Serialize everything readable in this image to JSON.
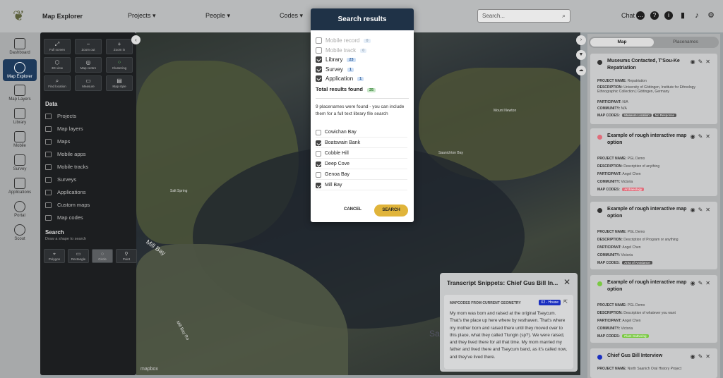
{
  "topbar": {
    "title": "Map Explorer",
    "nav": [
      "Projects",
      "People",
      "Codes"
    ],
    "search_placeholder": "Search...",
    "chat_label": "Chat"
  },
  "leftnav": [
    "Dashboard",
    "Map Explorer",
    "Map Layers",
    "Library",
    "Mobile",
    "Survey",
    "Applications",
    "Portal",
    "Scout"
  ],
  "sidepanel": {
    "tools": [
      "Full screen",
      "Zoom out",
      "Zoom in",
      "3D view",
      "Map centre",
      "Clustering",
      "Find location",
      "Measure",
      "Map style"
    ],
    "data_heading": "Data",
    "data_items": [
      "Projects",
      "Map layers",
      "Maps",
      "Mobile apps",
      "Mobile tracks",
      "Surveys",
      "Applications",
      "Custom maps",
      "Map codes"
    ],
    "search_heading": "Search",
    "search_sub": "Draw a shape to search",
    "shapes": [
      "Polygon",
      "Rectangle",
      "Circle",
      "Point"
    ]
  },
  "map": {
    "labels": [
      "Mill Bay",
      "Mill Bay Ro",
      "Sa",
      "Salt Spring",
      "Saanichton Bay",
      "Mount Newton"
    ],
    "attribution": "mapbox"
  },
  "modal": {
    "title": "Search results",
    "results": [
      {
        "label": "Mobile record",
        "count": "0",
        "checked": false,
        "disabled": true
      },
      {
        "label": "Mobile track",
        "count": "0",
        "checked": false,
        "disabled": true
      },
      {
        "label": "Library",
        "count": "23",
        "checked": true,
        "disabled": false
      },
      {
        "label": "Survey",
        "count": "1",
        "checked": true,
        "disabled": false
      },
      {
        "label": "Application",
        "count": "1",
        "checked": true,
        "disabled": false
      }
    ],
    "total_label": "Total results found",
    "total_count": "25",
    "info": "9 placenames were found - you can include them for a full text library file search",
    "placenames": [
      {
        "label": "Cowichan Bay",
        "checked": false
      },
      {
        "label": "Boatswain Bank",
        "checked": true
      },
      {
        "label": "Cobble Hill",
        "checked": false
      },
      {
        "label": "Deep Cove",
        "checked": true
      },
      {
        "label": "Genoa Bay",
        "checked": false
      },
      {
        "label": "Mill Bay",
        "checked": true
      }
    ],
    "cancel_label": "CANCEL",
    "search_label": "SEARCH"
  },
  "rightpanel": {
    "tab_map": "Map",
    "tab_placenames": "Placenames",
    "library_strip": "Library",
    "cards": [
      {
        "title": "Museums Contacted, T'Sou-Ke Repatriation",
        "dot_color": "#333333",
        "project_name": "Repatriation",
        "description": "University of Göttingen, Institute for Ethnology Ethnographic Collection | Göttingen, Germany",
        "participant": "N/A",
        "community": "N/A",
        "map_codes": [
          "Museum Location",
          "No Response"
        ],
        "tag_colors": [
          "#666666",
          "#555555"
        ]
      },
      {
        "title": "Example of rough interactive map option",
        "dot_color": "#e06c7a",
        "project_name": "PGL Demo",
        "description": "Description of anything",
        "participant": "Angel Chen",
        "community": "Victoria",
        "map_codes": [
          "Archaeology"
        ],
        "tag_colors": [
          "#e06c7a"
        ]
      },
      {
        "title": "Example of rough interactive map option",
        "dot_color": "#333333",
        "project_name": "PGL Demo",
        "description": "Description of Program or anything",
        "participant": "Angel Chen",
        "community": "Victoria",
        "map_codes": [
          "Area of Avoidance"
        ],
        "tag_colors": [
          "#555555"
        ]
      },
      {
        "title": "Example of rough interactive map option",
        "dot_color": "#7ac943",
        "project_name": "PGL Demo",
        "description": "Description of whatever you want",
        "participant": "Angel Chen",
        "community": "Victoria",
        "map_codes": [
          "Plant Gathering"
        ],
        "tag_colors": [
          "#7ac943"
        ]
      },
      {
        "title": "Chief Gus Bill Interview",
        "dot_color": "#1a2fc0",
        "project_name": "North Saanich Oral History Project"
      }
    ]
  },
  "transcript": {
    "title": "Transcript Snippets: Chief Gus Bill In...",
    "subtitle": "MAPCODES FROM CURRENT GEOMETRY",
    "tag": "X2 - House",
    "text": "My mom was born and raised at the original Tseycum. That's the place up here where by resthaven. That's where my mother born and raised there until they moved over to this place, what they called Tlungin (sp?). We were raised, and they lived there for all that time. My mom married my father and lived there and Tseycum band, as it's called now, and they've lived there."
  }
}
